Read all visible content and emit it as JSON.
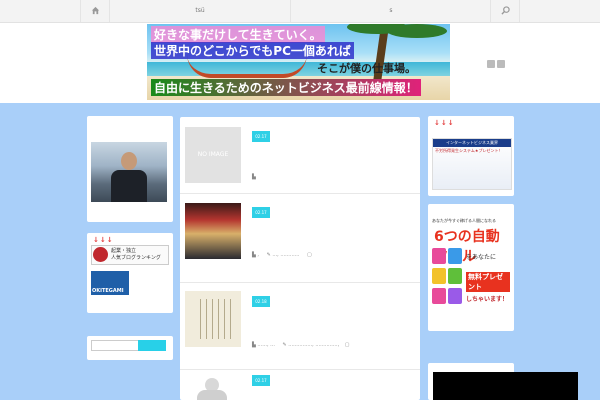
{
  "nav": {
    "items": [
      "tsü",
      "s"
    ],
    "icons": [
      "home-icon",
      "search-icon"
    ]
  },
  "header": {
    "banner_lines": [
      "好きな事だけして生きていく。",
      "世界中のどこからでもPC一個あれば",
      "そこが僕の仕事場。",
      "自由に生きるためのネットビジネス最前線情報！"
    ],
    "social_icons": [
      "rss-icon",
      "twitter-icon"
    ]
  },
  "left": {
    "rank_title": "↓↓↓",
    "rank_badge": [
      "起業・独立",
      "人気ブログランキング"
    ],
    "okitegami_label": "OKITEGAMI"
  },
  "posts": [
    {
      "thumb_text": "NO IMAGE",
      "date": "02.17",
      "meta": "▙",
      "tags": ""
    },
    {
      "thumb_text": "",
      "date": "02.17",
      "meta": "▙ ,",
      "tags": "✎ ..., ............"
    },
    {
      "thumb_text": "",
      "date": "02.18",
      "meta": "▙ ......, ...",
      "tags": "✎ ..............., ..............,"
    },
    {
      "thumb_text": "",
      "date": "02.17",
      "meta": "",
      "tags": ""
    }
  ],
  "right": {
    "section_title": "↓↓↓",
    "ad1_header": "インターネットビジネス業界",
    "ad1_sub": "不労所得発生システム★プレゼント！",
    "ad2_top": "あなたが今すぐ稼げる人間になれる",
    "ad2_big": "6つの自動ツール",
    "ad2_mid": "をあなたに",
    "ad2_free": "無料プレゼント",
    "ad2_end": "しちゃいます！"
  },
  "colors": {
    "accent": "#2fd0e6",
    "page_bg": "#a9cff9"
  }
}
